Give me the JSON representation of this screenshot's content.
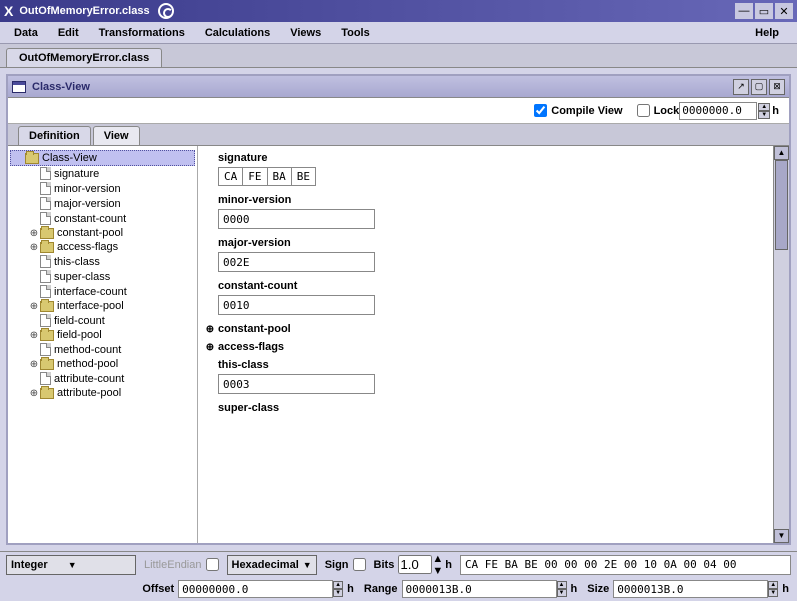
{
  "titlebar": {
    "title": "OutOfMemoryError.class"
  },
  "menubar": {
    "items": [
      "Data",
      "Edit",
      "Transformations",
      "Calculations",
      "Views",
      "Tools"
    ],
    "help": "Help"
  },
  "filetab": {
    "label": "OutOfMemoryError.class"
  },
  "panel": {
    "title": "Class-View",
    "compile_view": "Compile View",
    "lock": "Lock",
    "lock_value": "0000000.0",
    "h_suffix": "h"
  },
  "tabs": {
    "definition": "Definition",
    "view": "View"
  },
  "tree": {
    "root": "Class-View",
    "items": [
      {
        "type": "file",
        "label": "signature",
        "expandable": false
      },
      {
        "type": "file",
        "label": "minor-version",
        "expandable": false
      },
      {
        "type": "file",
        "label": "major-version",
        "expandable": false
      },
      {
        "type": "file",
        "label": "constant-count",
        "expandable": false
      },
      {
        "type": "folder",
        "label": "constant-pool",
        "expandable": true
      },
      {
        "type": "folder",
        "label": "access-flags",
        "expandable": true
      },
      {
        "type": "file",
        "label": "this-class",
        "expandable": false
      },
      {
        "type": "file",
        "label": "super-class",
        "expandable": false
      },
      {
        "type": "file",
        "label": "interface-count",
        "expandable": false
      },
      {
        "type": "folder",
        "label": "interface-pool",
        "expandable": true
      },
      {
        "type": "file",
        "label": "field-count",
        "expandable": false
      },
      {
        "type": "folder",
        "label": "field-pool",
        "expandable": true
      },
      {
        "type": "file",
        "label": "method-count",
        "expandable": false
      },
      {
        "type": "folder",
        "label": "method-pool",
        "expandable": true
      },
      {
        "type": "file",
        "label": "attribute-count",
        "expandable": false
      },
      {
        "type": "folder",
        "label": "attribute-pool",
        "expandable": true
      }
    ]
  },
  "details": {
    "signature": {
      "label": "signature",
      "bytes": [
        "CA",
        "FE",
        "BA",
        "BE"
      ]
    },
    "minor": {
      "label": "minor-version",
      "value": "0000"
    },
    "major": {
      "label": "major-version",
      "value": "002E"
    },
    "constant_count": {
      "label": "constant-count",
      "value": "0010"
    },
    "constant_pool": "constant-pool",
    "access_flags": "access-flags",
    "this_class": {
      "label": "this-class",
      "value": "0003"
    },
    "super_class": {
      "label": "super-class"
    }
  },
  "status": {
    "type_combo": "Integer",
    "endian": "LittleEndian",
    "format_combo": "Hexadecimal",
    "sign": "Sign",
    "bits": "Bits",
    "bits_value": "1.0",
    "h": "h",
    "hexline": "CA FE BA BE 00 00 00 2E 00 10 0A 00 04 00",
    "offset": {
      "label": "Offset",
      "value": "00000000.0"
    },
    "range": {
      "label": "Range",
      "value": "0000013B.0"
    },
    "size": {
      "label": "Size",
      "value": "0000013B.0"
    }
  }
}
